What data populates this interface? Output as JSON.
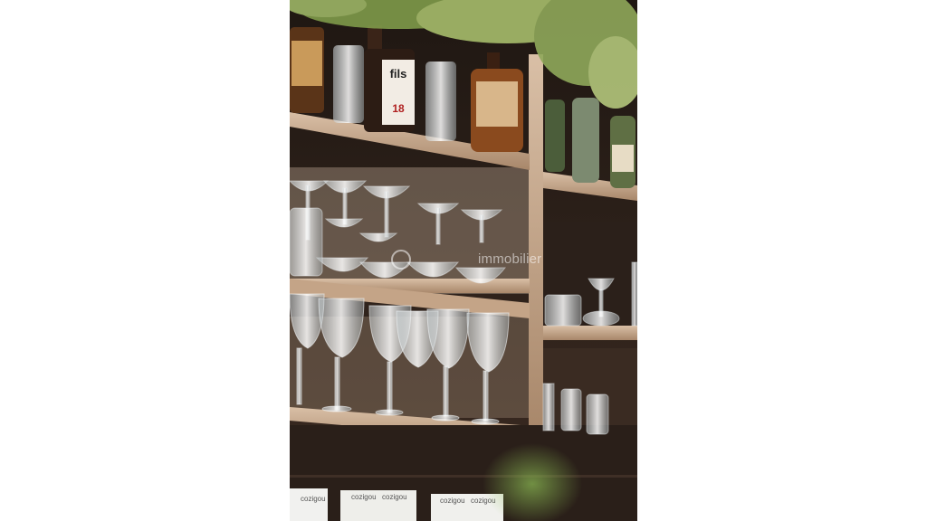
{
  "photo": {
    "description_visible_text": {
      "bottle_label_brand": "fils",
      "bottle_label_number": "18",
      "watermark": "immobilier",
      "card_label_1": "cozigou",
      "card_label_2": "cozigou",
      "card_label_3": "cozigou",
      "card_label_4": "cozigou",
      "card_label_5": "cozigou"
    }
  },
  "colors": {
    "shelf_wood": "#c9a88a",
    "cabinet_dark": "#3a2a22",
    "greenery": "#9fb565",
    "background": "#ffffff"
  }
}
